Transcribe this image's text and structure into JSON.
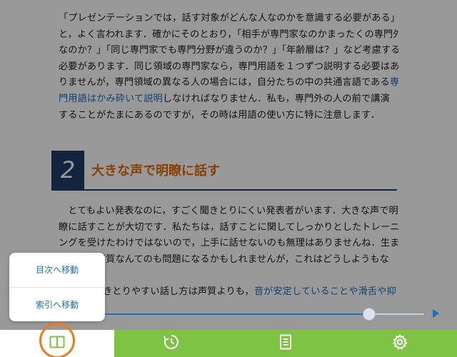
{
  "page": {
    "paragraph1": [
      {
        "text": "「プレゼンテーションでは，話す対象がどんな人なのかを意識する必要がある」"
      },
      {
        "text": "と，よく言われます．確かにそのとおり，「相手が専門家なのかまったくの専門外"
      },
      {
        "text": "なのか？」「同じ専門家でも専門分野が違うのか？」「年齢層は？」など考慮する"
      },
      {
        "text": "必要があります．同じ領域の専門家なら，専門用語を１つずつ説明する必要はあ"
      },
      {
        "text": "りませんが，専門領域の異なる人の場合には，自分たちの中の共通言語である",
        "highlight": "専"
      },
      {
        "text": "しなければなりません．私も，専門外の人の前で講演",
        "highlight_lead": "門用語はかみ砕いて説明"
      },
      {
        "text": "することがたまにあるのですが，その時は用語の使い方に特に注意します．"
      }
    ],
    "section": {
      "number": "2",
      "title": "大きな声で明瞭に話す"
    },
    "paragraph2": [
      {
        "text": "　とてもよい発表なのに，すごく聞きとりにくい発表者がいます．大きな声で明"
      },
      {
        "text": "瞭に話すことが大切です．私たちは，話すことに関してしっかりとしたトレーニ"
      },
      {
        "text": "ングを受けたわけではないので，上手に話せないのも無理はありませんね．生ま"
      },
      {
        "text": "れつきの声質なんてのも問題になるかもしれませんが，これはどうしようもな"
      },
      {
        "text": "",
        "highlight": ""
      },
      {
        "text": "きとりやすい話し方は声質よりも，",
        "highlight": "音が安定していることや滑舌や抑"
      }
    ]
  },
  "slider": {
    "position": 0.83
  },
  "popup": {
    "toc_label": "目次へ移動",
    "index_label": "索引へ移動"
  },
  "toolbar": {
    "active": "toc",
    "icons": [
      "book-icon",
      "history-icon",
      "document-icon",
      "gear-icon"
    ]
  },
  "colors": {
    "accent_green": "#7dc242",
    "link_blue": "#1b6fbf",
    "highlight_ring": "#f07a1a",
    "section_title": "#e46c0a",
    "section_box": "#1f3c68"
  }
}
